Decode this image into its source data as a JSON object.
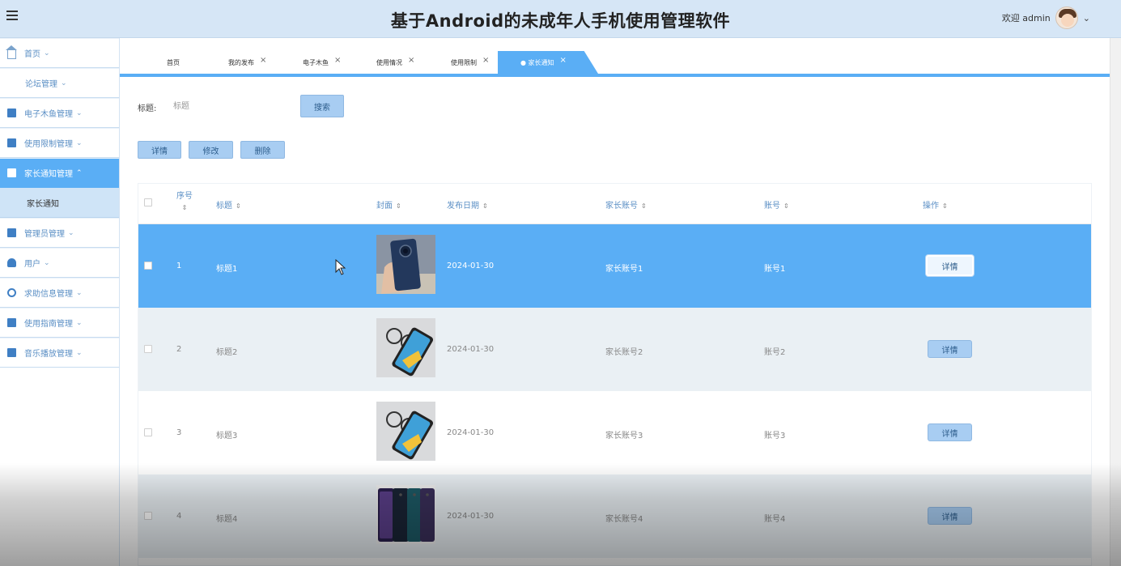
{
  "header": {
    "title": "基于Android的未成年人手机使用管理软件",
    "welcome": "欢迎 admin"
  },
  "sidebar": {
    "items": [
      {
        "label": "首页",
        "icon": "home-icon"
      },
      {
        "label": "论坛管理",
        "icon": ""
      },
      {
        "label": "电子木鱼管理",
        "icon": "image-icon"
      },
      {
        "label": "使用限制管理",
        "icon": "layout-icon"
      },
      {
        "label": "家长通知管理",
        "icon": "doc-icon",
        "active": true
      },
      {
        "label": "管理员管理",
        "icon": "grid-icon"
      },
      {
        "label": "用户",
        "icon": "user-icon"
      },
      {
        "label": "求助信息管理",
        "icon": "help-icon"
      },
      {
        "label": "使用指南管理",
        "icon": "print-icon"
      },
      {
        "label": "音乐播放管理",
        "icon": "card-icon"
      }
    ],
    "active_sub": "家长通知"
  },
  "tabs": [
    {
      "label": "首页",
      "closable": false
    },
    {
      "label": "我的发布",
      "closable": true
    },
    {
      "label": "电子木鱼",
      "closable": true
    },
    {
      "label": "使用情况",
      "closable": true
    },
    {
      "label": "使用限制",
      "closable": true
    },
    {
      "label": "● 家长通知",
      "closable": true,
      "active": true
    }
  ],
  "search": {
    "label": "标题:",
    "placeholder": "标题",
    "button": "搜索"
  },
  "actions": {
    "detail": "详情",
    "edit": "修改",
    "delete": "删除"
  },
  "table": {
    "columns": {
      "seq_top": "序号",
      "title": "标题",
      "cover": "封面",
      "date": "发布日期",
      "parent_account": "家长账号",
      "account": "账号",
      "ops": "操作"
    },
    "rows": [
      {
        "seq": "1",
        "title": "标题1",
        "date": "2024-01-30",
        "parent_account": "家长账号1",
        "account": "账号1",
        "op": "详情"
      },
      {
        "seq": "2",
        "title": "标题2",
        "date": "2024-01-30",
        "parent_account": "家长账号2",
        "account": "账号2",
        "op": "详情"
      },
      {
        "seq": "3",
        "title": "标题3",
        "date": "2024-01-30",
        "parent_account": "家长账号3",
        "account": "账号3",
        "op": "详情"
      },
      {
        "seq": "4",
        "title": "标题4",
        "date": "2024-01-30",
        "parent_account": "家长账号4",
        "account": "账号4",
        "op": "详情"
      }
    ]
  },
  "colors": {
    "accent": "#5aaef5",
    "header_bg": "#d6e6f6",
    "button_bg": "#a8cdf2"
  }
}
